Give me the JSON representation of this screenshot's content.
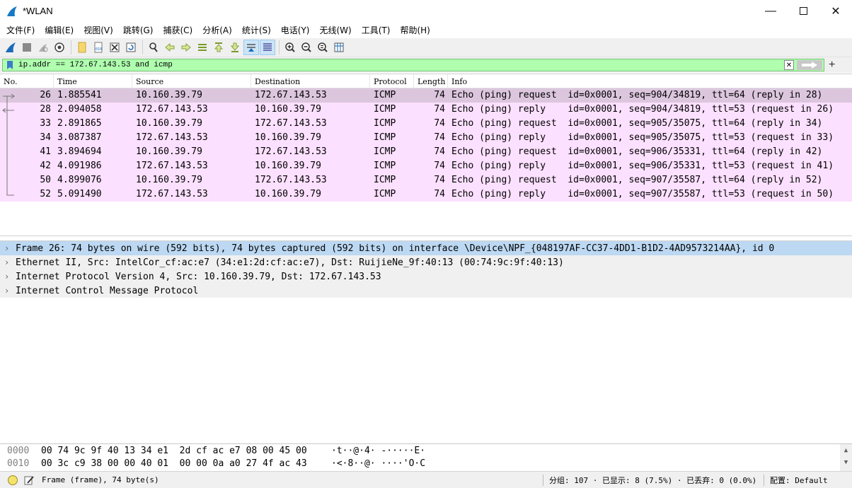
{
  "window": {
    "title": "*WLAN",
    "minimize_icon": "minimize-icon",
    "maximize_icon": "maximize-icon",
    "close_icon": "close-icon"
  },
  "menu": [
    "文件(F)",
    "编辑(E)",
    "视图(V)",
    "跳转(G)",
    "捕获(C)",
    "分析(A)",
    "统计(S)",
    "电话(Y)",
    "无线(W)",
    "工具(T)",
    "帮助(H)"
  ],
  "toolbar": {
    "icons": [
      "start-capture-icon",
      "stop-capture-icon",
      "restart-capture-icon",
      "capture-options-icon",
      "open-file-icon",
      "save-file-icon",
      "close-file-icon",
      "reload-file-icon",
      "find-packet-icon",
      "go-back-icon",
      "go-forward-icon",
      "go-to-packet-icon",
      "go-first-icon",
      "go-last-icon",
      "autoscroll-icon",
      "colorize-icon",
      "zoom-in-icon",
      "zoom-out-icon",
      "zoom-normal-icon",
      "resize-columns-icon"
    ]
  },
  "filter": {
    "value": "ip.addr == 172.67.143.53 and icmp",
    "bg_color": "#afffaf"
  },
  "packet_list": {
    "columns": [
      "No.",
      "Time",
      "Source",
      "Destination",
      "Protocol",
      "Length",
      "Info"
    ],
    "rows": [
      {
        "no": "26",
        "time": "1.885541",
        "src": "10.160.39.79",
        "dst": "172.67.143.53",
        "proto": "ICMP",
        "len": "74",
        "info": "Echo (ping) request  id=0x0001, seq=904/34819, ttl=64 (reply in 28)"
      },
      {
        "no": "28",
        "time": "2.094058",
        "src": "172.67.143.53",
        "dst": "10.160.39.79",
        "proto": "ICMP",
        "len": "74",
        "info": "Echo (ping) reply    id=0x0001, seq=904/34819, ttl=53 (request in 26)"
      },
      {
        "no": "33",
        "time": "2.891865",
        "src": "10.160.39.79",
        "dst": "172.67.143.53",
        "proto": "ICMP",
        "len": "74",
        "info": "Echo (ping) request  id=0x0001, seq=905/35075, ttl=64 (reply in 34)"
      },
      {
        "no": "34",
        "time": "3.087387",
        "src": "172.67.143.53",
        "dst": "10.160.39.79",
        "proto": "ICMP",
        "len": "74",
        "info": "Echo (ping) reply    id=0x0001, seq=905/35075, ttl=53 (request in 33)"
      },
      {
        "no": "41",
        "time": "3.894694",
        "src": "10.160.39.79",
        "dst": "172.67.143.53",
        "proto": "ICMP",
        "len": "74",
        "info": "Echo (ping) request  id=0x0001, seq=906/35331, ttl=64 (reply in 42)"
      },
      {
        "no": "42",
        "time": "4.091986",
        "src": "172.67.143.53",
        "dst": "10.160.39.79",
        "proto": "ICMP",
        "len": "74",
        "info": "Echo (ping) reply    id=0x0001, seq=906/35331, ttl=53 (request in 41)"
      },
      {
        "no": "50",
        "time": "4.899076",
        "src": "10.160.39.79",
        "dst": "172.67.143.53",
        "proto": "ICMP",
        "len": "74",
        "info": "Echo (ping) request  id=0x0001, seq=907/35587, ttl=64 (reply in 52)"
      },
      {
        "no": "52",
        "time": "5.091490",
        "src": "172.67.143.53",
        "dst": "10.160.39.79",
        "proto": "ICMP",
        "len": "74",
        "info": "Echo (ping) reply    id=0x0001, seq=907/35587, ttl=53 (request in 50)"
      }
    ],
    "row_color": "#fce0ff",
    "selected_color": "#dcc6de"
  },
  "details": [
    "Frame 26: 74 bytes on wire (592 bits), 74 bytes captured (592 bits) on interface \\Device\\NPF_{048197AF-CC37-4DD1-B1D2-4AD9573214AA}, id 0",
    "Ethernet II, Src: IntelCor_cf:ac:e7 (34:e1:2d:cf:ac:e7), Dst: RuijieNe_9f:40:13 (00:74:9c:9f:40:13)",
    "Internet Protocol Version 4, Src: 10.160.39.79, Dst: 172.67.143.53",
    "Internet Control Message Protocol"
  ],
  "bytes": [
    {
      "offset": "0000",
      "hex": "00 74 9c 9f 40 13 34 e1  2d cf ac e7 08 00 45 00",
      "ascii": "·t··@·4· -·····E·"
    },
    {
      "offset": "0010",
      "hex": "00 3c c9 38 00 00 40 01  00 00 0a a0 27 4f ac 43",
      "ascii": "·<·8··@· ····'O·C"
    }
  ],
  "status": {
    "frame": "Frame (frame), 74 byte(s)",
    "stats": "分组: 107 · 已显示: 8 (7.5%) · 已丢弃: 0 (0.0%)",
    "profile": "配置: Default"
  }
}
